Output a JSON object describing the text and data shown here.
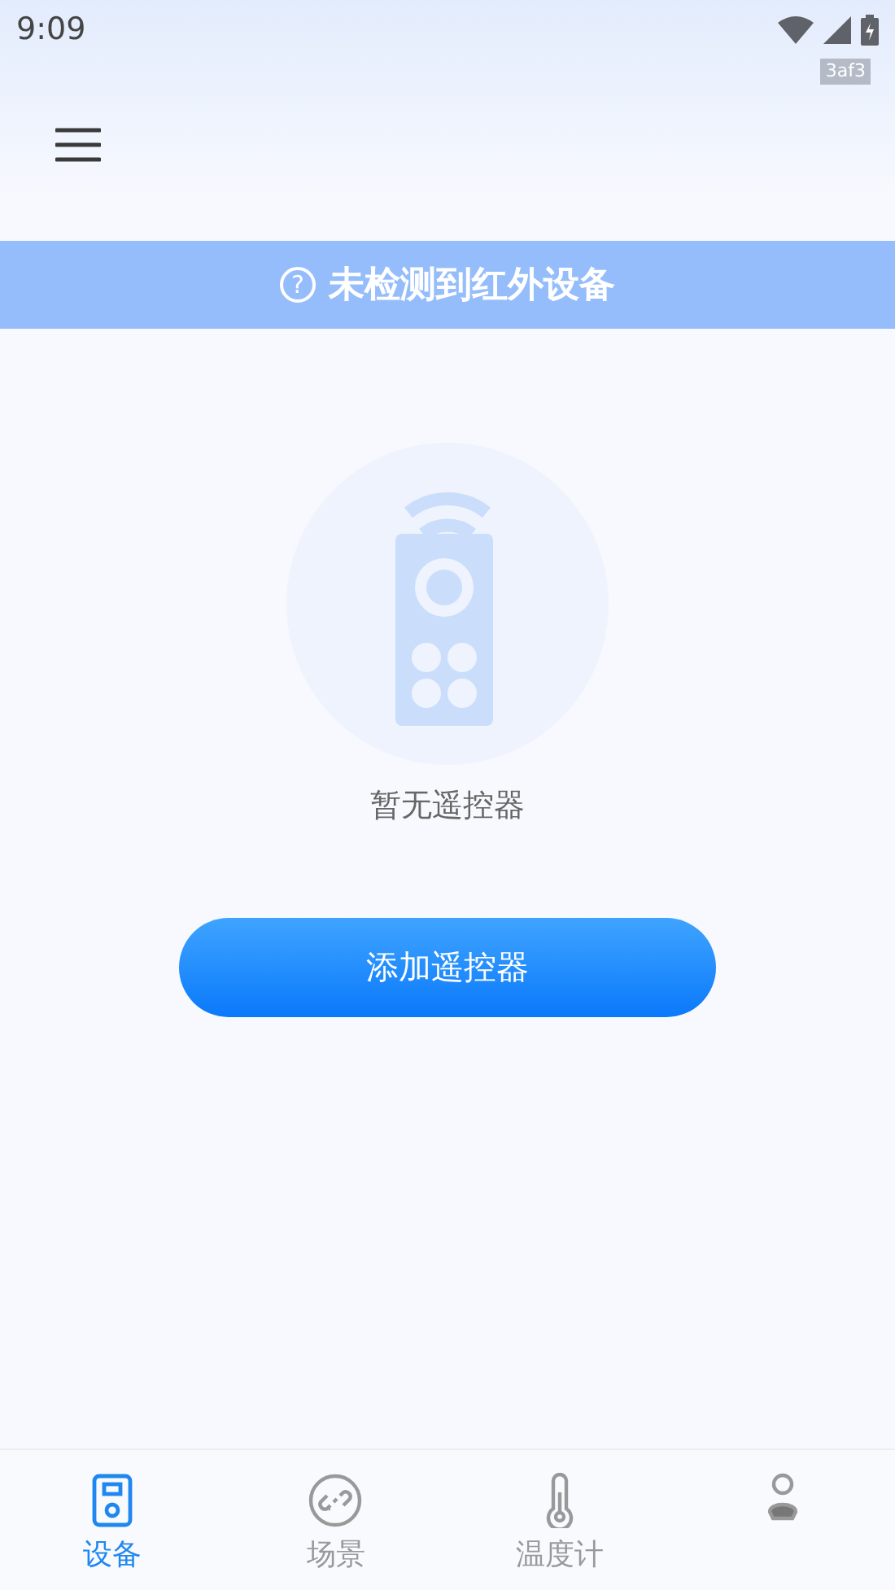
{
  "status_bar": {
    "time": "9:09",
    "badge": "3af3"
  },
  "banner": {
    "icon": "?",
    "text": "未检测到红外设备"
  },
  "empty_state": {
    "text": "暂无遥控器"
  },
  "add_button": {
    "label": "添加遥控器"
  },
  "bottom_nav": [
    {
      "kind": "device",
      "label": "设备",
      "selected": true
    },
    {
      "kind": "scene",
      "label": "场景",
      "selected": false
    },
    {
      "kind": "thermometer",
      "label": "温度计",
      "selected": false
    },
    {
      "kind": "person",
      "selected": false
    }
  ]
}
